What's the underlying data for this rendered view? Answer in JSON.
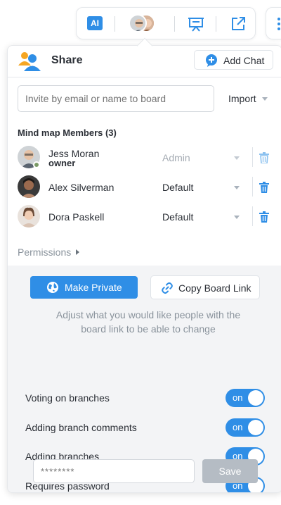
{
  "toolbar": {
    "ai_label": "AI",
    "icons": [
      "ai-icon",
      "avatar-stack",
      "presentation-icon",
      "share-external-icon",
      "kebab-menu-icon"
    ]
  },
  "colors": {
    "accent": "#2f8ee6",
    "disabled": "#b5bcc4",
    "lower_bg": "#f3f4f6"
  },
  "header": {
    "title": "Share",
    "add_chat_label": "Add Chat"
  },
  "invite": {
    "placeholder": "Invite by email or name to board",
    "import_label": "Import"
  },
  "members": {
    "title": "Mind map Members (3)",
    "list": [
      {
        "name": "Jess Moran",
        "role": "owner",
        "permission": "Admin"
      },
      {
        "name": "Alex Silverman",
        "permission": "Default"
      },
      {
        "name": "Dora Paskell",
        "permission": "Default"
      }
    ]
  },
  "permissions_label": "Permissions",
  "actions": {
    "make_private_label": "Make Private",
    "copy_link_label": "Copy Board Link"
  },
  "adjust_text": "Adjust what you would like people with the board link to be able to change",
  "settings": [
    {
      "label": "Voting on branches",
      "state": "on"
    },
    {
      "label": "Adding branch comments",
      "state": "on"
    },
    {
      "label": "Adding branches",
      "state": "on"
    },
    {
      "label": "Requires password",
      "state": "on"
    }
  ],
  "password": {
    "placeholder": "********",
    "save_label": "Save"
  }
}
